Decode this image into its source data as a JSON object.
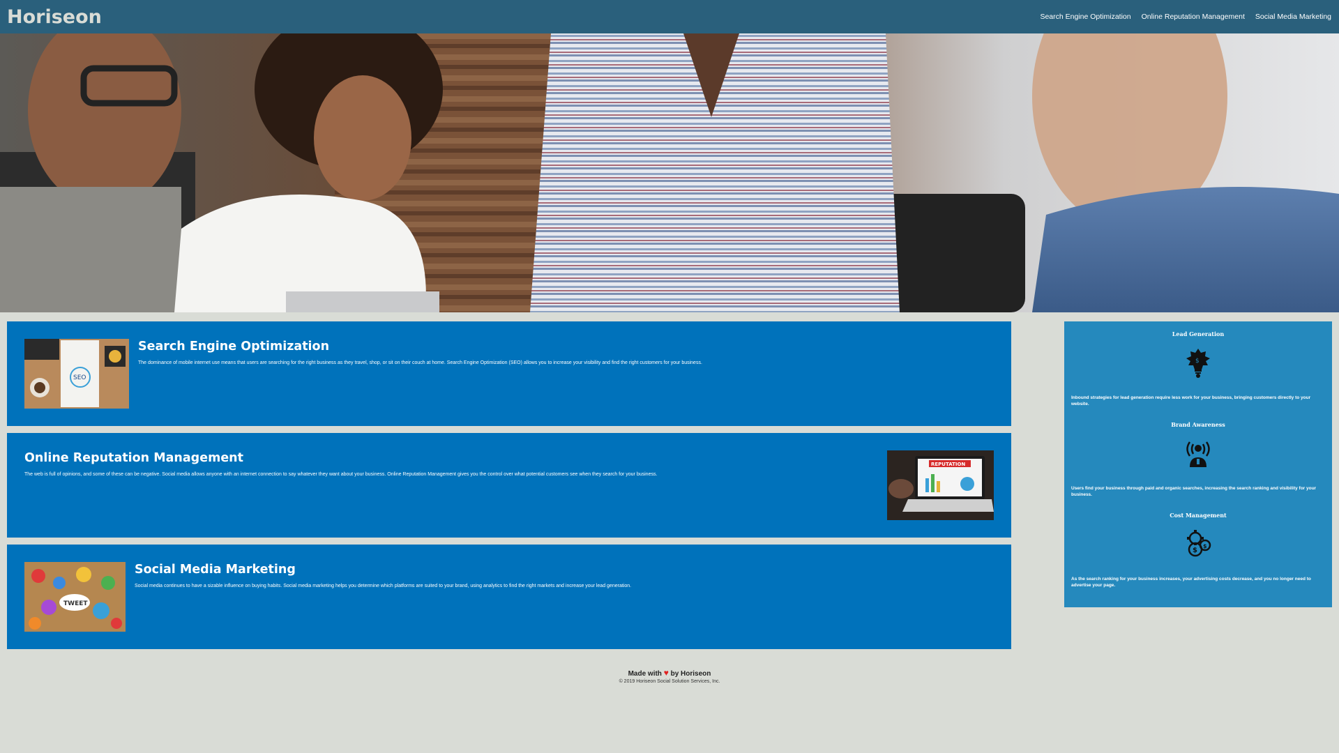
{
  "header": {
    "logo": "Horiseon",
    "nav": [
      {
        "label": "Search Engine Optimization"
      },
      {
        "label": "Online Reputation Management"
      },
      {
        "label": "Social Media Marketing"
      }
    ]
  },
  "cards": [
    {
      "title": "Search Engine Optimization",
      "text": "The dominance of mobile internet use means that users are searching for the right business as they travel, shop, or sit on their couch at home. Search Engine Optimization (SEO) allows you to increase your visibility and find the right customers for your business.",
      "image_label": "SEO"
    },
    {
      "title": "Online Reputation Management",
      "text": "The web is full of opinions, and some of these can be negative. Social media allows anyone with an internet connection to say whatever they want about your business. Online Reputation Management gives you the control over what potential customers see when they search for your business.",
      "image_label": "REPUTATION"
    },
    {
      "title": "Social Media Marketing",
      "text": "Social media continues to have a sizable influence on buying habits. Social media marketing helps you determine which platforms are suited to your brand, using analytics to find the right markets and increase your lead generation.",
      "image_label": "TWEET"
    }
  ],
  "benefits": [
    {
      "title": "Lead Generation",
      "icon": "lightbulb-dollar-icon",
      "text": "Inbound strategies for lead generation require less work for your business, bringing customers directly to your website."
    },
    {
      "title": "Brand Awareness",
      "icon": "broadcast-person-icon",
      "text": "Users find your business through paid and organic searches, increasing the search ranking and visibility for your business."
    },
    {
      "title": "Cost Management",
      "icon": "gear-dollar-icon",
      "text": "As the search ranking for your business increases, your advertising costs decrease, and you no longer need to advertise your page."
    }
  ],
  "footer": {
    "made_prefix": "Made with",
    "made_suffix": "by Horiseon",
    "heart": "♥",
    "copyright": "© 2019 Horiseon Social Solution Services, Inc."
  },
  "colors": {
    "header_bg": "#2a607c",
    "card_bg": "#0072bb",
    "sidebar_bg": "#2589bd",
    "page_bg": "#d9dcd6",
    "heart": "#e0201f"
  }
}
